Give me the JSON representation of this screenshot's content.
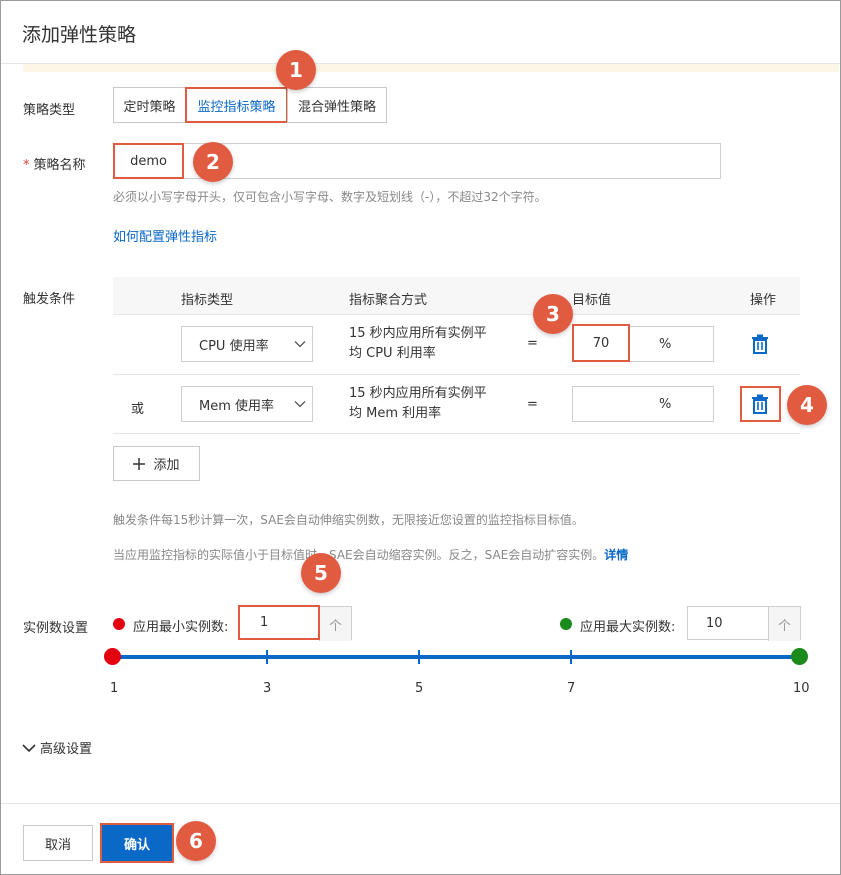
{
  "header": {
    "title": "添加弹性策略"
  },
  "policy_type": {
    "label": "策略类型",
    "options": [
      "定时策略",
      "监控指标策略",
      "混合弹性策略"
    ],
    "selected": "监控指标策略"
  },
  "policy_name": {
    "required_mark": "*",
    "label": "策略名称",
    "value": "demo",
    "hint": "必须以小写字母开头，仅可包含小写字母、数字及短划线（-），不超过32个字符。",
    "help_link": "如何配置弹性指标"
  },
  "trigger": {
    "label": "触发条件",
    "columns": [
      "指标类型",
      "指标聚合方式",
      "目标值",
      "操作"
    ],
    "rows": [
      {
        "prefix": "",
        "metric": "CPU 使用率",
        "agg_line1": "15 秒内应用所有实例平",
        "agg_line2": "均 CPU 利用率",
        "op": "=",
        "target": "70",
        "unit": "%"
      },
      {
        "prefix": "或",
        "metric": "Mem 使用率",
        "agg_line1": "15 秒内应用所有实例平",
        "agg_line2": "均 Mem 利用率",
        "op": "=",
        "target": "",
        "unit": "%"
      }
    ],
    "add_label": "添加",
    "note1": "触发条件每15秒计算一次，SAE会自动伸缩实例数，无限接近您设置的监控指标目标值。",
    "note2": "当应用监控指标的实际值小于目标值时，SAE会自动缩容实例。反之，SAE会自动扩容实例。",
    "note2_link": "详情"
  },
  "instances": {
    "label": "实例数设置",
    "min_label": "应用最小实例数:",
    "min_value": "1",
    "max_label": "应用最大实例数:",
    "max_value": "10",
    "min_color": "#e3000f",
    "max_color": "#1a8a1a",
    "scale_labels": [
      "1",
      "3",
      "5",
      "7",
      "10"
    ],
    "stepper_glyph": "个"
  },
  "advanced": {
    "label": "高级设置"
  },
  "footer": {
    "cancel_label": "取消",
    "confirm_label": "确认"
  },
  "badges": [
    "1",
    "2",
    "3",
    "4",
    "5",
    "6"
  ],
  "colors": {
    "accent": "#0a68c7",
    "highlight": "#e05b3f"
  }
}
